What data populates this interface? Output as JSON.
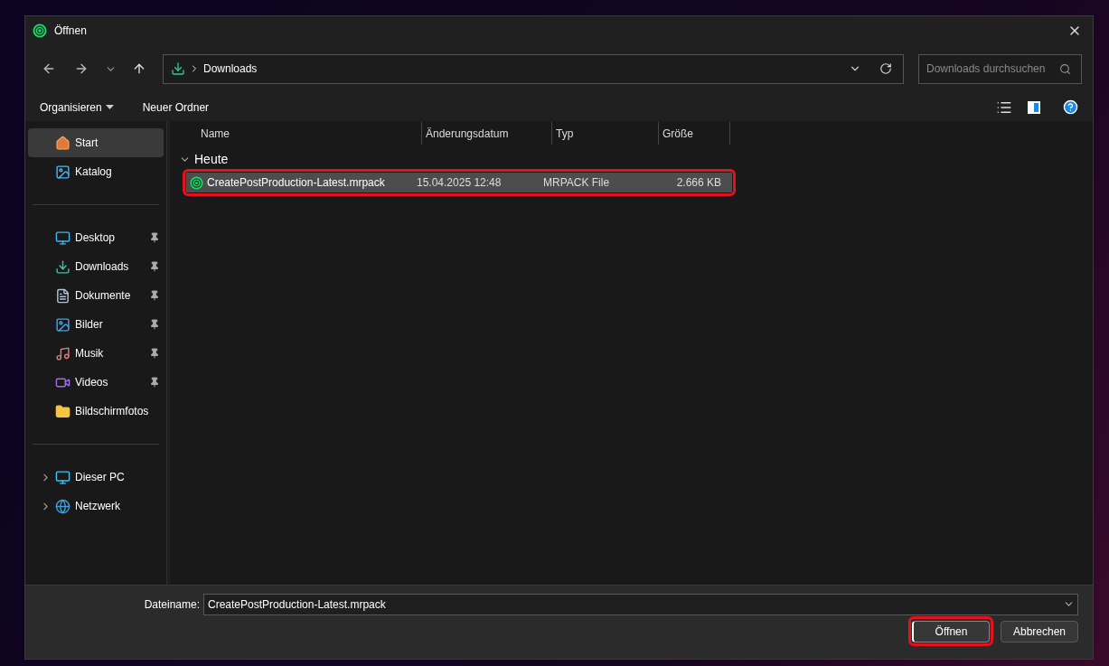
{
  "window": {
    "title": "Öffnen"
  },
  "address": {
    "path": "Downloads"
  },
  "search": {
    "placeholder": "Downloads durchsuchen"
  },
  "toolbar": {
    "organize": "Organisieren",
    "new_folder": "Neuer Ordner"
  },
  "sidebar": {
    "sections": [
      {
        "items": [
          {
            "label": "Start",
            "selected": true,
            "pinned": false
          },
          {
            "label": "Katalog",
            "selected": false,
            "pinned": false
          }
        ]
      },
      {
        "items": [
          {
            "label": "Desktop",
            "selected": false,
            "pinned": true
          },
          {
            "label": "Downloads",
            "selected": false,
            "pinned": true
          },
          {
            "label": "Dokumente",
            "selected": false,
            "pinned": true
          },
          {
            "label": "Bilder",
            "selected": false,
            "pinned": true
          },
          {
            "label": "Musik",
            "selected": false,
            "pinned": true
          },
          {
            "label": "Videos",
            "selected": false,
            "pinned": true
          },
          {
            "label": "Bildschirmfotos",
            "selected": false,
            "pinned": false
          }
        ]
      },
      {
        "items": [
          {
            "label": "Dieser PC",
            "selected": false,
            "pinned": false,
            "expanded": false
          },
          {
            "label": "Netzwerk",
            "selected": false,
            "pinned": false,
            "expanded": false
          }
        ]
      }
    ]
  },
  "table": {
    "columns": [
      "Name",
      "Änderungsdatum",
      "Typ",
      "Größe"
    ],
    "groups": [
      {
        "label": "Heute",
        "expanded": true,
        "rows": [
          {
            "name": "CreatePostProduction-Latest.mrpack",
            "date": "15.04.2025 12:48",
            "type": "MRPACK File",
            "size": "2.666 KB",
            "selected": true,
            "highlighted": true
          }
        ]
      }
    ]
  },
  "footer": {
    "filename_label": "Dateiname:",
    "filename": "CreatePostProduction-Latest.mrpack",
    "buttons": [
      {
        "label": "Öffnen",
        "default": true,
        "highlighted": true
      },
      {
        "label": "Abbrechen",
        "default": false,
        "highlighted": false
      }
    ]
  }
}
